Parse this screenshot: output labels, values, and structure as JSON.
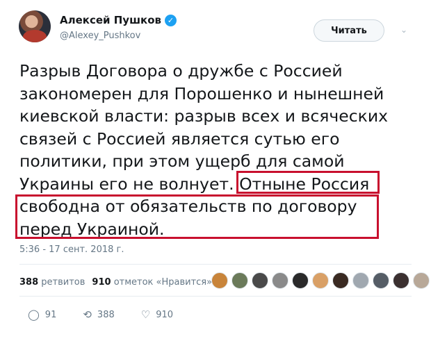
{
  "author": {
    "name": "Алексей Пушков",
    "handle": "@Alexey_Pushkov",
    "verified_glyph": "✓"
  },
  "follow_button": {
    "label": "Читать"
  },
  "menu_caret": "⌄",
  "tweet": {
    "text_before": "Разрыв Договора о дружбе с Россией закономерен для Порошенко и нынешней киевской власти: разрыв всех и всяческих связей с Россией является сутью его политики, при этом ущерб для самой Украины его не волнует.",
    "text_highlight_1": "Отныне Россия",
    "text_highlight_2": "свободна от обязательств по договору перед Украиной."
  },
  "timestamp": "5:36 - 17 сент. 2018 г.",
  "stats": {
    "retweets_count": "388",
    "retweets_label": "ретвитов",
    "likes_count": "910",
    "likes_label": "отметок «Нравится»"
  },
  "likers": [
    {
      "color": "#c8843a"
    },
    {
      "color": "#6b7a5a"
    },
    {
      "color": "#4a4a4a"
    },
    {
      "color": "#8a8a8a"
    },
    {
      "color": "#2a2a2a"
    },
    {
      "color": "#d9a066"
    },
    {
      "color": "#3a2a22"
    },
    {
      "color": "#a0a8b0"
    },
    {
      "color": "#555d66"
    },
    {
      "color": "#3b3030"
    },
    {
      "color": "#b8a898"
    }
  ],
  "actions": {
    "reply": {
      "icon": "reply-icon",
      "glyph": "◯",
      "count": "91"
    },
    "retweet": {
      "icon": "retweet-icon",
      "glyph": "⟲",
      "count": "388"
    },
    "like": {
      "icon": "heart-icon",
      "glyph": "♡",
      "count": "910"
    }
  },
  "colors": {
    "highlight_border": "#c8102e",
    "verified": "#1da1f2",
    "muted": "#657786"
  }
}
